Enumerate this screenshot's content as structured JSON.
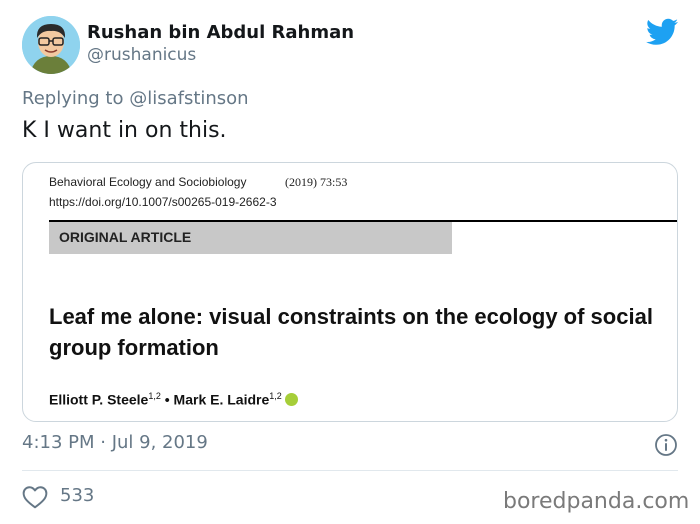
{
  "author": {
    "display_name": "Rushan bin Abdul Rahman",
    "handle": "@rushanicus",
    "avatar_icon": "cartoon-avatar"
  },
  "reply": {
    "text": "Replying to @lisafstinson"
  },
  "tweet": {
    "text": "K I want in on this."
  },
  "embed": {
    "journal": "Behavioral Ecology and Sociobiology",
    "volume": "(2019) 73:53",
    "doi": "https://doi.org/10.1007/s00265-019-2662-3",
    "article_type": "ORIGINAL ARTICLE",
    "title": "Leaf me alone: visual constraints on the ecology of social group formation",
    "authors": [
      {
        "name": "Elliott P. Steele",
        "affil": "1,2"
      },
      {
        "name": "Mark E. Laidre",
        "affil": "1,2"
      }
    ],
    "separator": " • "
  },
  "meta": {
    "timestamp": "4:13 PM · Jul 9, 2019"
  },
  "actions": {
    "likes": "533"
  },
  "watermark": "boredpanda.com",
  "colors": {
    "twitter_blue": "#1da1f2",
    "muted": "#657786",
    "orcid_green": "#a6ce39"
  }
}
